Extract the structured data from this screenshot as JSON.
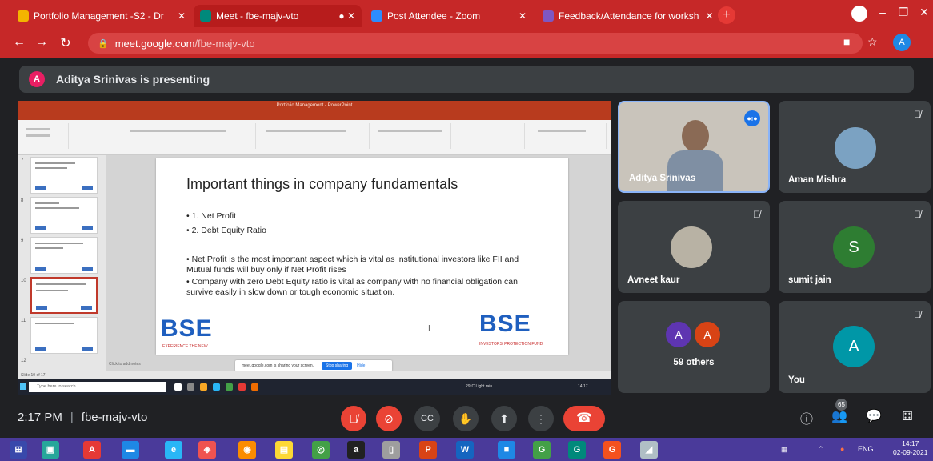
{
  "browser": {
    "tabs": [
      {
        "title": "Portfolio Management -S2 - Dr",
        "color": "#f4b400"
      },
      {
        "title": "Meet - fbe-majv-vto",
        "color": "#00897b"
      },
      {
        "title": "Post Attendee - Zoom",
        "color": "#2d8cff"
      },
      {
        "title": "Feedback/Attendance for worksh",
        "color": "#7e57c2"
      }
    ],
    "url_host": "meet.google.com",
    "url_path": "/fbe-majv-vto",
    "profile_initial": "A"
  },
  "banner": {
    "avatar_initial": "A",
    "text": "Aditya Srinivas is presenting"
  },
  "presentation": {
    "window_title": "Portfolio Management - PowerPoint",
    "slide_title": "Important things in company fundamentals",
    "points": [
      "• 1. Net Profit",
      "• 2. Debt Equity Ratio"
    ],
    "details": [
      "• Net Profit is the most important aspect which is vital as institutional investors like FII and Mutual funds will buy only if Net Profit rises",
      "• Company with zero Debt Equity ratio is vital as company with no financial obligation can survive easily in slow down or tough economic situation."
    ],
    "logo_left": "BSE",
    "logo_left_tag": "EXPERIENCE THE NEW",
    "logo_right": "BSE",
    "logo_right_tag": "INVESTORS' PROTECTION FUND",
    "share_bar_text": "meet.google.com is sharing your screen.",
    "share_stop_label": "Stop sharing",
    "share_hide_label": "Hide",
    "search_placeholder": "Type here to search",
    "notes_placeholder": "Click to add notes",
    "status_text": "Slide 10 of 17",
    "tray_weather": "29°C Light rain",
    "tray_time": "14:17"
  },
  "participants": [
    {
      "name": "Aditya Srinivas",
      "speaking": true
    },
    {
      "name": "Aman Mishra",
      "muted": true
    },
    {
      "name": "Avneet kaur",
      "muted": true
    },
    {
      "name": "sumit jain",
      "initial": "S",
      "color": "#2e7d32",
      "muted": true
    },
    {
      "name": "59 others",
      "initials": [
        "A",
        "A"
      ],
      "colors": [
        "#5e35b1",
        "#d84315"
      ]
    },
    {
      "name": "You",
      "initial": "A",
      "color": "#0097a7",
      "muted": true
    }
  ],
  "meeting": {
    "time": "2:17 PM",
    "code": "fbe-majv-vto",
    "people_count": "65"
  },
  "taskbar": {
    "lang": "ENG",
    "time": "14:17",
    "date": "02-09-2021"
  }
}
